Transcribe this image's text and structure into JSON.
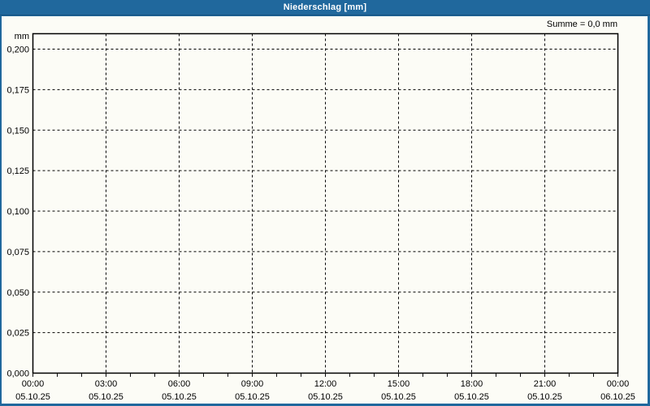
{
  "window": {
    "title": "Niederschlag [mm]"
  },
  "header": {
    "sum_label": "Summe = 0,0 mm"
  },
  "colors": {
    "frame_blue": "#20689d",
    "titlebar_divider": "#17527e",
    "title_text": "#ffffff",
    "content_background": "#fcfcf6",
    "grid_line": "#000000",
    "axis_line": "#000000",
    "label_text": "#000000"
  },
  "chart_data": {
    "type": "bar",
    "title": "Niederschlag [mm]",
    "ylabel": "mm",
    "xlabel": "",
    "annotation": "Summe = 0,0 mm",
    "sum": {
      "value": 0.0,
      "unit": "mm",
      "display": "0,0 mm"
    },
    "ylim": [
      0,
      0.21
    ],
    "xlim_hours": [
      0,
      24
    ],
    "grid": "dashed",
    "legend": "none",
    "y_ticks": [
      {
        "value": 0.0,
        "label": "0,000"
      },
      {
        "value": 0.025,
        "label": "0,025"
      },
      {
        "value": 0.05,
        "label": "0,050"
      },
      {
        "value": 0.075,
        "label": "0,075"
      },
      {
        "value": 0.1,
        "label": "0,100"
      },
      {
        "value": 0.125,
        "label": "0,125"
      },
      {
        "value": 0.15,
        "label": "0,150"
      },
      {
        "value": 0.175,
        "label": "0,175"
      },
      {
        "value": 0.2,
        "label": "0,200"
      }
    ],
    "x_ticks": [
      {
        "hour": 0,
        "time": "00:00",
        "date": "05.10.25"
      },
      {
        "hour": 3,
        "time": "03:00",
        "date": "05.10.25"
      },
      {
        "hour": 6,
        "time": "06:00",
        "date": "05.10.25"
      },
      {
        "hour": 9,
        "time": "09:00",
        "date": "05.10.25"
      },
      {
        "hour": 12,
        "time": "12:00",
        "date": "05.10.25"
      },
      {
        "hour": 15,
        "time": "15:00",
        "date": "05.10.25"
      },
      {
        "hour": 18,
        "time": "18:00",
        "date": "05.10.25"
      },
      {
        "hour": 21,
        "time": "21:00",
        "date": "05.10.25"
      },
      {
        "hour": 24,
        "time": "00:00",
        "date": "06.10.25"
      }
    ],
    "minor_tick_every_hours": 1,
    "series": [
      {
        "name": "Niederschlag",
        "unit": "mm",
        "values": []
      }
    ]
  }
}
